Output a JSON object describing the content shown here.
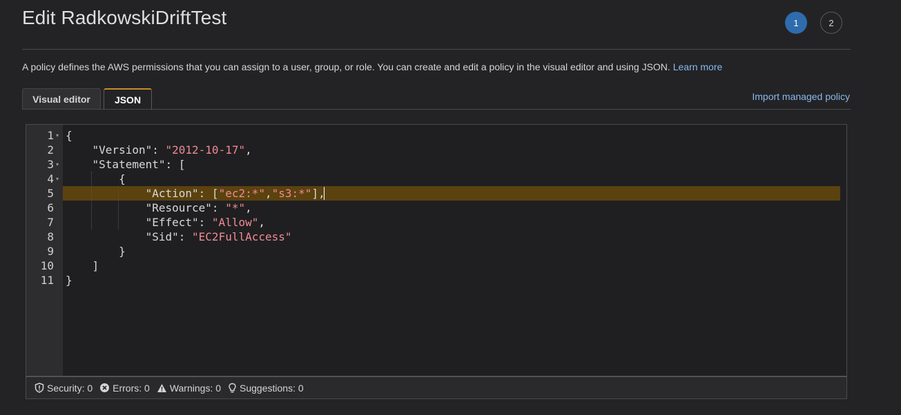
{
  "header": {
    "title": "Edit RadkowskiDriftTest",
    "steps": [
      "1",
      "2"
    ]
  },
  "description": {
    "text": "A policy defines the AWS permissions that you can assign to a user, group, or role. You can create and edit a policy in the visual editor and using JSON.",
    "link": "Learn more"
  },
  "tabs": {
    "visual": "Visual editor",
    "json": "JSON",
    "active": "JSON"
  },
  "import_link": "Import managed policy",
  "editor": {
    "line_numbers": [
      "1",
      "2",
      "3",
      "4",
      "5",
      "6",
      "7",
      "8",
      "9",
      "10",
      "11"
    ],
    "lines": [
      [
        {
          "t": "{",
          "c": "p"
        }
      ],
      [
        {
          "t": "    ",
          "c": "p"
        },
        {
          "t": "\"Version\"",
          "c": "k"
        },
        {
          "t": ": ",
          "c": "p"
        },
        {
          "t": "\"2012-10-17\"",
          "c": "s"
        },
        {
          "t": ",",
          "c": "p"
        }
      ],
      [
        {
          "t": "    ",
          "c": "p"
        },
        {
          "t": "\"Statement\"",
          "c": "k"
        },
        {
          "t": ": [",
          "c": "p"
        }
      ],
      [
        {
          "t": "        {",
          "c": "p"
        }
      ],
      [
        {
          "t": "            ",
          "c": "p"
        },
        {
          "t": "\"Action\"",
          "c": "k"
        },
        {
          "t": ": [",
          "c": "p"
        },
        {
          "t": "\"ec2:*\"",
          "c": "s"
        },
        {
          "t": ",",
          "c": "p"
        },
        {
          "t": "\"s3:*\"",
          "c": "s"
        },
        {
          "t": "],",
          "c": "p"
        }
      ],
      [
        {
          "t": "            ",
          "c": "p"
        },
        {
          "t": "\"Resource\"",
          "c": "k"
        },
        {
          "t": ": ",
          "c": "p"
        },
        {
          "t": "\"*\"",
          "c": "s"
        },
        {
          "t": ",",
          "c": "p"
        }
      ],
      [
        {
          "t": "            ",
          "c": "p"
        },
        {
          "t": "\"Effect\"",
          "c": "k"
        },
        {
          "t": ": ",
          "c": "p"
        },
        {
          "t": "\"Allow\"",
          "c": "s"
        },
        {
          "t": ",",
          "c": "p"
        }
      ],
      [
        {
          "t": "            ",
          "c": "p"
        },
        {
          "t": "\"Sid\"",
          "c": "k"
        },
        {
          "t": ": ",
          "c": "p"
        },
        {
          "t": "\"EC2FullAccess\"",
          "c": "s"
        }
      ],
      [
        {
          "t": "        }",
          "c": "p"
        }
      ],
      [
        {
          "t": "    ]",
          "c": "p"
        }
      ],
      [
        {
          "t": "}",
          "c": "p"
        }
      ]
    ],
    "foldable_lines": [
      1,
      3,
      4
    ],
    "active_line": 5
  },
  "status": {
    "security": "Security: 0",
    "errors": "Errors: 0",
    "warnings": "Warnings: 0",
    "suggestions": "Suggestions: 0"
  },
  "colors": {
    "accent": "#2f6cad",
    "link": "#89b8ec",
    "string": "#f08a94",
    "active_line_bg": "#5b420f",
    "tab_accent": "#c98a2b"
  }
}
